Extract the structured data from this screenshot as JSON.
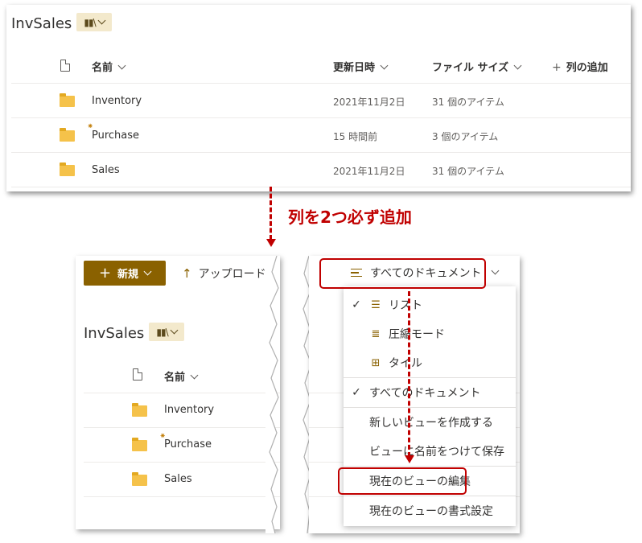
{
  "top": {
    "title": "InvSales",
    "columns": {
      "name": "名前",
      "modified": "更新日時",
      "size": "ファイル サイズ",
      "add_column": "列の追加"
    },
    "rows": [
      {
        "name": "Inventory",
        "modified": "2021年11月2日",
        "size": "31 個のアイテム"
      },
      {
        "name": "Purchase",
        "modified": "15 時間前",
        "size": "3 個のアイテム"
      },
      {
        "name": "Sales",
        "modified": "2021年11月2日",
        "size": "31 個のアイテム"
      }
    ]
  },
  "annotation": "列を2つ必ず追加",
  "bottom_left": {
    "new_label": "新規",
    "upload_label": "アップロード",
    "title": "InvSales",
    "column_name": "名前",
    "rows": [
      {
        "name": "Inventory"
      },
      {
        "name": "Purchase"
      },
      {
        "name": "Sales"
      }
    ]
  },
  "bottom_right": {
    "view_label": "すべてのドキュメント",
    "menu": {
      "list": "リスト",
      "compact": "圧縮モード",
      "tiles": "タイル",
      "all_docs": "すべてのドキュメント",
      "create_view": "新しいビューを作成する",
      "save_as": "ビューに名前をつけて保存",
      "edit_view": "現在のビューの編集",
      "format_view": "現在のビューの書式設定"
    }
  },
  "colors": {
    "accent": "#8a6100",
    "annotation_red": "#c00000",
    "folder": "#f5c24a"
  },
  "icons": [
    "document-icon",
    "folder-icon",
    "library-icon",
    "chevron-down-icon",
    "plus-icon",
    "upload-icon",
    "check-icon",
    "list-view-icon",
    "compact-view-icon",
    "tiles-view-icon"
  ]
}
